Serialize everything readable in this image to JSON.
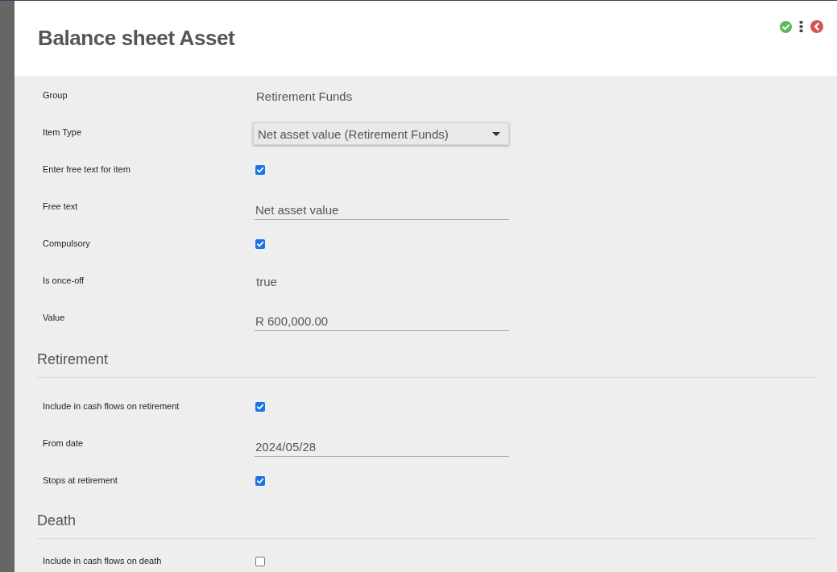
{
  "header": {
    "title": "Balance sheet Asset"
  },
  "fields": [
    {
      "kind": "text",
      "label": "Group",
      "value": "Retirement Funds"
    },
    {
      "kind": "select",
      "label": "Item Type",
      "value": "Net asset value (Retirement Funds)"
    },
    {
      "kind": "checkbox",
      "label": "Enter free text for item",
      "checked": true
    },
    {
      "kind": "input",
      "label": "Free text",
      "value": "Net asset value"
    },
    {
      "kind": "checkbox",
      "label": "Compulsory",
      "checked": true
    },
    {
      "kind": "text",
      "label": "Is once-off",
      "value": "true"
    },
    {
      "kind": "input",
      "label": "Value",
      "value": "R 600,000.00"
    }
  ],
  "sections": [
    {
      "title": "Retirement",
      "fields": [
        {
          "kind": "checkbox",
          "label": "Include in cash flows on retirement",
          "checked": true
        },
        {
          "kind": "input",
          "label": "From date",
          "value": "2024/05/28"
        },
        {
          "kind": "checkbox",
          "label": "Stops at retirement",
          "checked": true
        }
      ]
    },
    {
      "title": "Death",
      "fields": [
        {
          "kind": "checkbox",
          "label": "Include in cash flows on death",
          "checked": false
        }
      ]
    }
  ]
}
